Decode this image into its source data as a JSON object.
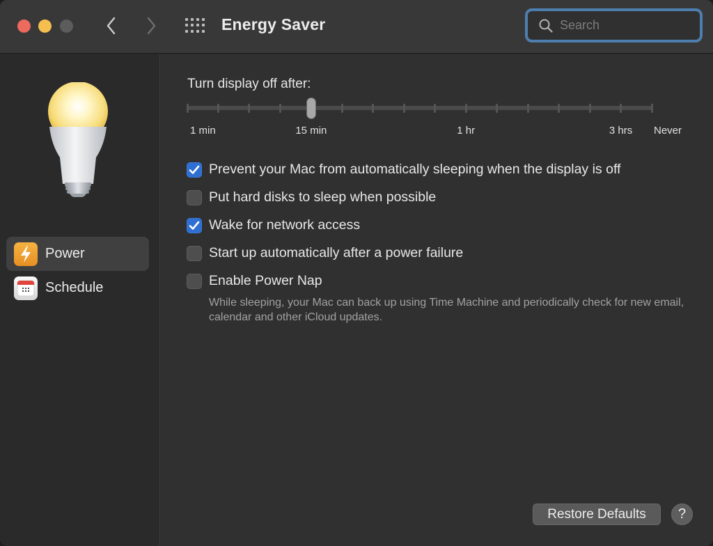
{
  "window": {
    "title": "Energy Saver",
    "accent_color": "#2f6fd1",
    "search": {
      "placeholder": "Search",
      "value": ""
    }
  },
  "toolbar": {
    "back_icon": "chevron-left-icon",
    "forward_icon": "chevron-right-icon",
    "show_all_icon": "grid-icon"
  },
  "sidebar": {
    "items": [
      {
        "label": "Power",
        "icon": "lightning-bolt-icon",
        "selected": true
      },
      {
        "label": "Schedule",
        "icon": "calendar-icon",
        "selected": false
      }
    ]
  },
  "main": {
    "slider": {
      "label": "Turn display off after:",
      "positions": 16,
      "selected_index": 4,
      "selected_value": "15 min",
      "tick_labels": [
        {
          "text": "1 min",
          "index": 0
        },
        {
          "text": "15 min",
          "index": 4
        },
        {
          "text": "1 hr",
          "index": 9
        },
        {
          "text": "3 hrs",
          "index": 14
        },
        {
          "text": "Never",
          "index": 15
        }
      ]
    },
    "options": [
      {
        "label": "Prevent your Mac from automatically sleeping when the display is off",
        "checked": true
      },
      {
        "label": "Put hard disks to sleep when possible",
        "checked": false
      },
      {
        "label": "Wake for network access",
        "checked": true
      },
      {
        "label": "Start up automatically after a power failure",
        "checked": false
      },
      {
        "label": "Enable Power Nap",
        "checked": false
      }
    ],
    "power_nap_description": "While sleeping, your Mac can back up using Time Machine and periodically check for new email, calendar and other iCloud updates.",
    "restore_defaults_label": "Restore Defaults",
    "help_label": "?"
  }
}
